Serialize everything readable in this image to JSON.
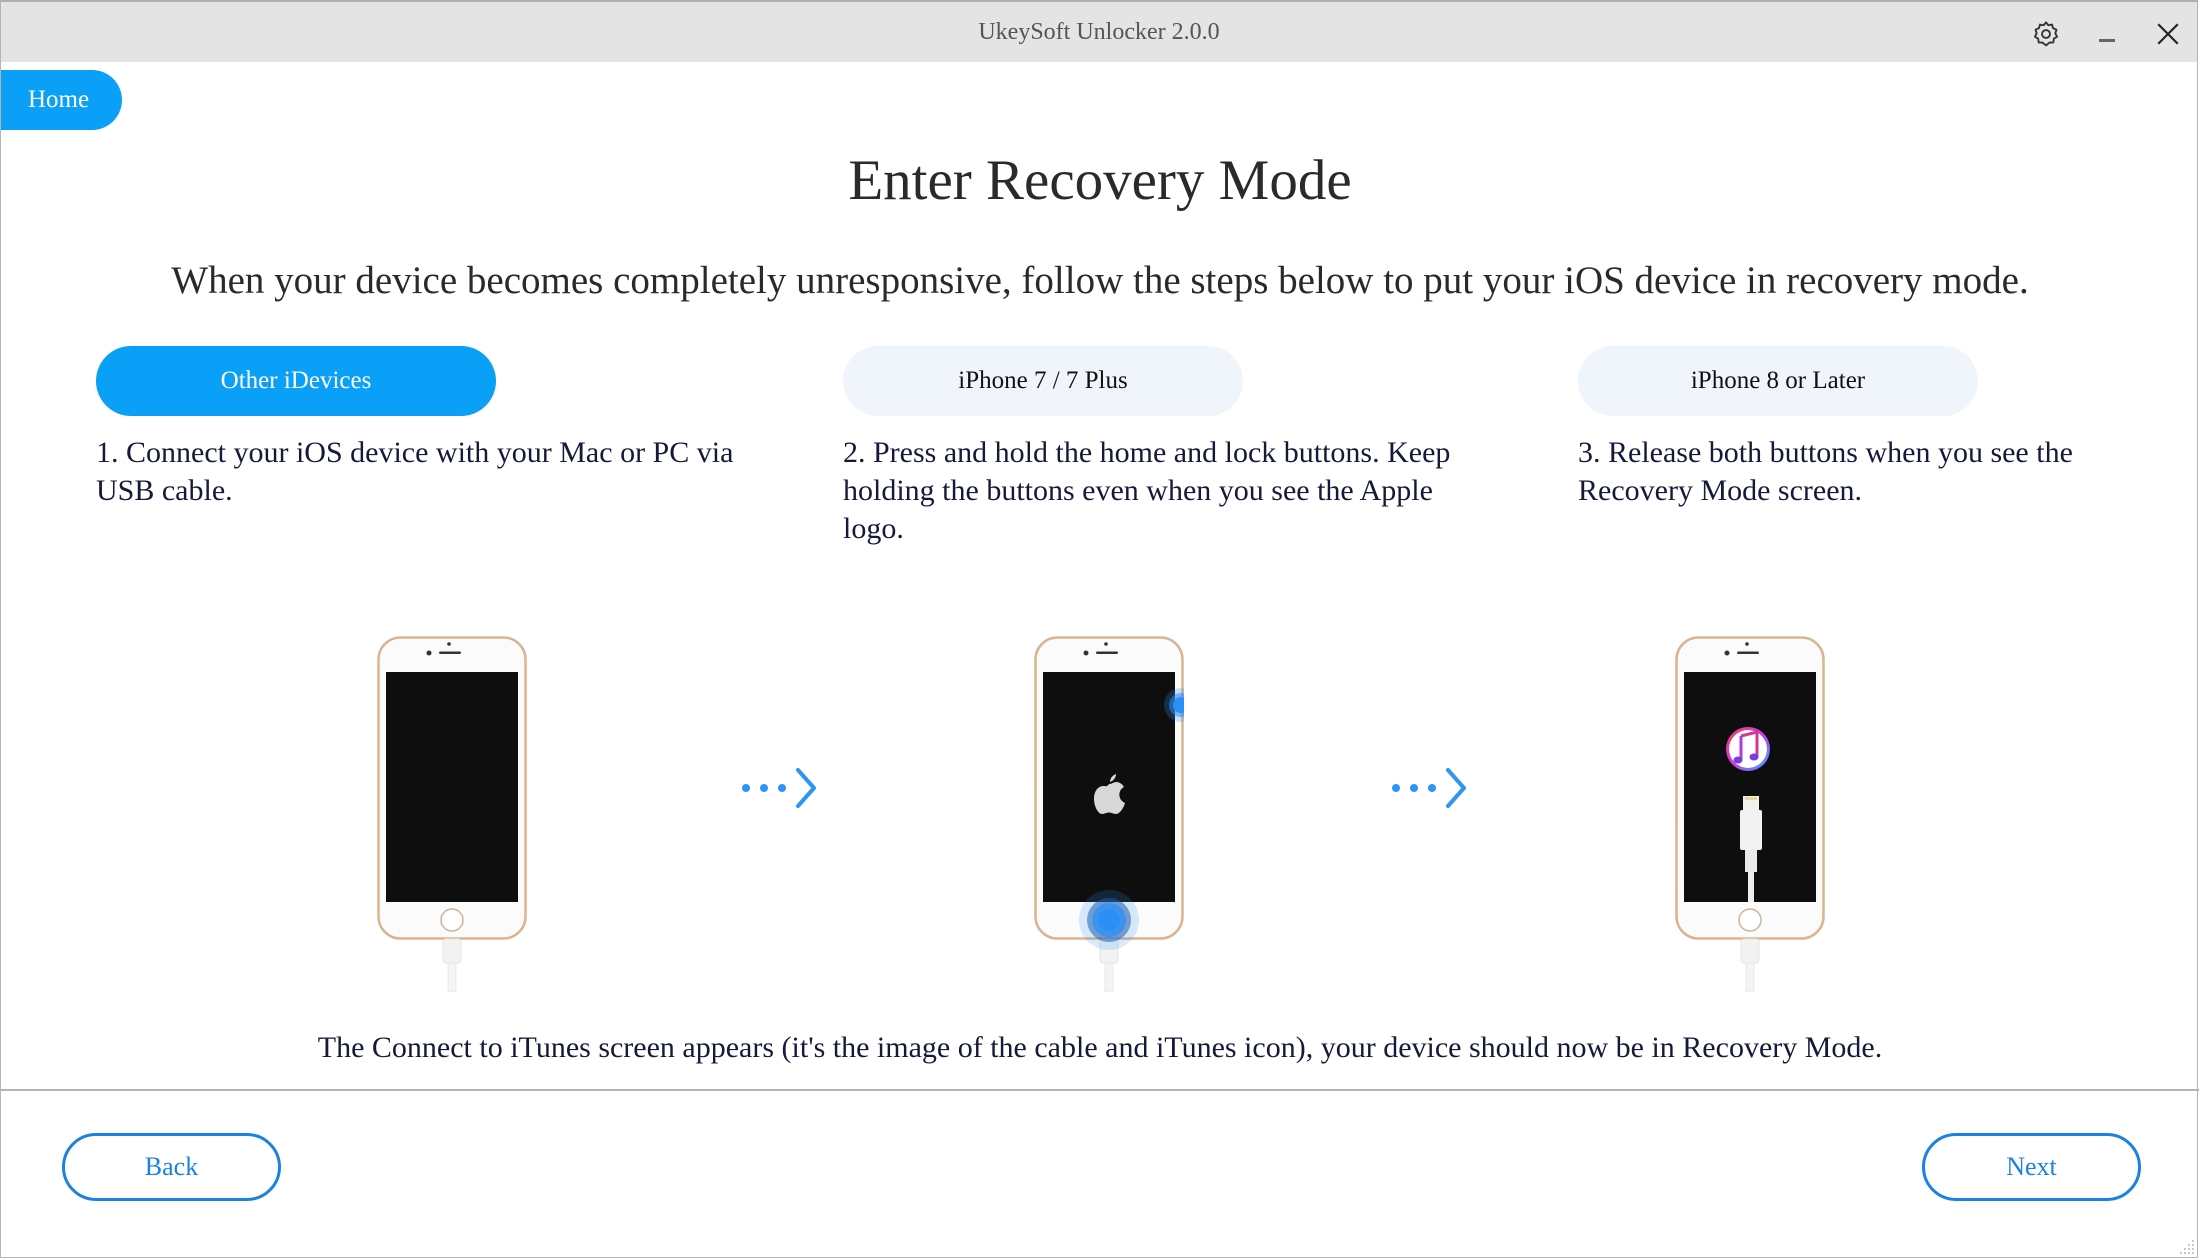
{
  "window": {
    "title": "UkeySoft Unlocker 2.0.0",
    "controls": [
      "settings",
      "minimize",
      "close"
    ]
  },
  "nav": {
    "home_label": "Home"
  },
  "main": {
    "heading": "Enter Recovery Mode",
    "subtitle": "When your device becomes completely unresponsive, follow the steps below to put your iOS device in recovery mode.",
    "tabs": [
      {
        "label": "Other iDevices",
        "active": true
      },
      {
        "label": "iPhone 7 / 7 Plus",
        "active": false
      },
      {
        "label": "iPhone 8 or Later",
        "active": false
      }
    ],
    "steps": [
      {
        "text": "1. Connect your iOS device with your Mac or PC via USB cable."
      },
      {
        "text": "2. Press and hold the home and lock buttons. Keep holding the buttons even when you see the Apple logo."
      },
      {
        "text": "3. Release both buttons when you see the Recovery Mode screen."
      }
    ],
    "illustrations": [
      {
        "screen": "blank",
        "icon": "iphone-connected-icon"
      },
      {
        "screen": "apple-logo",
        "icon": "iphone-press-buttons-icon"
      },
      {
        "screen": "connect-to-itunes",
        "icon": "iphone-recovery-mode-icon"
      }
    ],
    "caption": "The Connect to iTunes screen appears (it's the image of the cable and iTunes icon), your device should now be in Recovery Mode."
  },
  "footer": {
    "back_label": "Back",
    "next_label": "Next"
  },
  "colors": {
    "accent": "#0aa0f8",
    "button_border": "#1a82e0",
    "inactive_tab": "#eff5fb",
    "titlebar": "#e4e4e4",
    "highlight_blue": "#2b8ff5"
  }
}
